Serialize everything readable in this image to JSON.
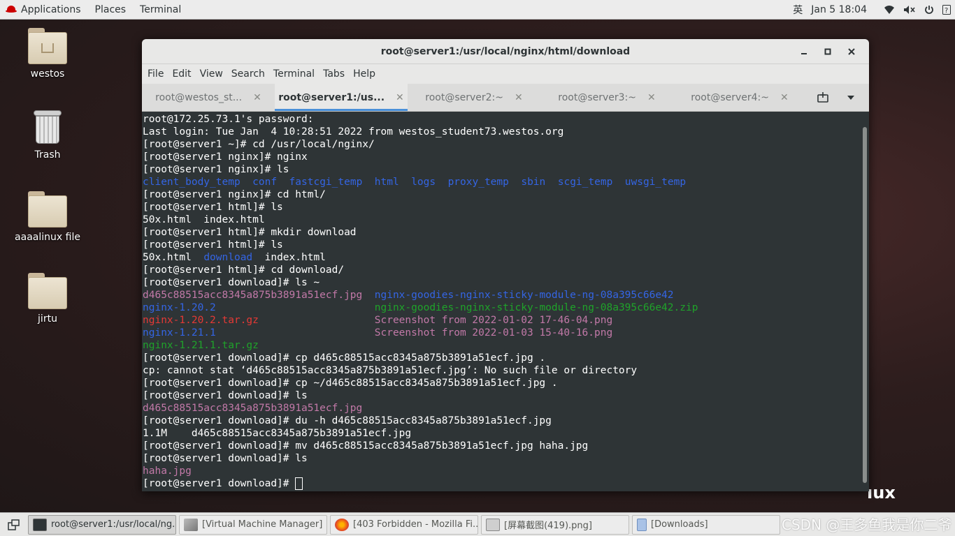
{
  "topbar": {
    "applications": "Applications",
    "places": "Places",
    "terminal": "Terminal",
    "input_method": "英",
    "datetime": "Jan 5  18:04"
  },
  "desktop": {
    "icons": [
      {
        "label": "westos"
      },
      {
        "label": "Trash"
      },
      {
        "label": "aaaalinux file"
      },
      {
        "label": "jirtu"
      }
    ],
    "brand_text": "ıux"
  },
  "window": {
    "title": "root@server1:/usr/local/nginx/html/download",
    "menu": [
      "File",
      "Edit",
      "View",
      "Search",
      "Terminal",
      "Tabs",
      "Help"
    ],
    "tabs": [
      {
        "label": "root@westos_st...",
        "active": false
      },
      {
        "label": "root@server1:/us...",
        "active": true
      },
      {
        "label": "root@server2:~",
        "active": false
      },
      {
        "label": "root@server3:~",
        "active": false
      },
      {
        "label": "root@server4:~",
        "active": false
      }
    ]
  },
  "terminal": {
    "lines": [
      [
        {
          "t": "root@172.25.73.1's password:",
          "c": ""
        }
      ],
      [
        {
          "t": "Last login: Tue Jan  4 10:28:51 2022 from westos_student73.westos.org",
          "c": ""
        }
      ],
      [
        {
          "t": "[root@server1 ~]# cd /usr/local/nginx/",
          "c": ""
        }
      ],
      [
        {
          "t": "[root@server1 nginx]# nginx",
          "c": ""
        }
      ],
      [
        {
          "t": "[root@server1 nginx]# ls",
          "c": ""
        }
      ],
      [
        {
          "t": "client_body_temp",
          "c": "c-blue"
        },
        {
          "t": "  ",
          "c": ""
        },
        {
          "t": "conf",
          "c": "c-blue"
        },
        {
          "t": "  ",
          "c": ""
        },
        {
          "t": "fastcgi_temp",
          "c": "c-blue"
        },
        {
          "t": "  ",
          "c": ""
        },
        {
          "t": "html",
          "c": "c-blue"
        },
        {
          "t": "  ",
          "c": ""
        },
        {
          "t": "logs",
          "c": "c-blue"
        },
        {
          "t": "  ",
          "c": ""
        },
        {
          "t": "proxy_temp",
          "c": "c-blue"
        },
        {
          "t": "  ",
          "c": ""
        },
        {
          "t": "sbin",
          "c": "c-blue"
        },
        {
          "t": "  ",
          "c": ""
        },
        {
          "t": "scgi_temp",
          "c": "c-blue"
        },
        {
          "t": "  ",
          "c": ""
        },
        {
          "t": "uwsgi_temp",
          "c": "c-blue"
        }
      ],
      [
        {
          "t": "[root@server1 nginx]# cd html/",
          "c": ""
        }
      ],
      [
        {
          "t": "[root@server1 html]# ls",
          "c": ""
        }
      ],
      [
        {
          "t": "50x.html  index.html",
          "c": ""
        }
      ],
      [
        {
          "t": "[root@server1 html]# mkdir download",
          "c": ""
        }
      ],
      [
        {
          "t": "[root@server1 html]# ls",
          "c": ""
        }
      ],
      [
        {
          "t": "50x.html  ",
          "c": ""
        },
        {
          "t": "download",
          "c": "c-blue"
        },
        {
          "t": "  index.html",
          "c": ""
        }
      ],
      [
        {
          "t": "[root@server1 html]# cd download/",
          "c": ""
        }
      ],
      [
        {
          "t": "[root@server1 download]# ls ~",
          "c": ""
        }
      ],
      [
        {
          "t": "d465c88515acc8345a875b3891a51ecf.jpg",
          "c": "c-pink"
        },
        {
          "t": "  ",
          "c": ""
        },
        {
          "t": "nginx-goodies-nginx-sticky-module-ng-08a395c66e42",
          "c": "c-blue"
        }
      ],
      [
        {
          "t": "nginx-1.20.2",
          "c": "c-blue"
        },
        {
          "t": "                          ",
          "c": ""
        },
        {
          "t": "nginx-goodies-nginx-sticky-module-ng-08a395c66e42.zip",
          "c": "c-green"
        }
      ],
      [
        {
          "t": "nginx-1.20.2.tar.gz",
          "c": "c-red"
        },
        {
          "t": "                   ",
          "c": ""
        },
        {
          "t": "Screenshot from 2022-01-02 17-46-04.png",
          "c": "c-pink"
        }
      ],
      [
        {
          "t": "nginx-1.21.1",
          "c": "c-blue"
        },
        {
          "t": "                          ",
          "c": ""
        },
        {
          "t": "Screenshot from 2022-01-03 15-40-16.png",
          "c": "c-pink"
        }
      ],
      [
        {
          "t": "nginx-1.21.1.tar.gz",
          "c": "c-green"
        }
      ],
      [
        {
          "t": "[root@server1 download]# cp d465c88515acc8345a875b3891a51ecf.jpg .",
          "c": ""
        }
      ],
      [
        {
          "t": "cp: cannot stat ‘d465c88515acc8345a875b3891a51ecf.jpg’: No such file or directory",
          "c": ""
        }
      ],
      [
        {
          "t": "[root@server1 download]# cp ~/d465c88515acc8345a875b3891a51ecf.jpg .",
          "c": ""
        }
      ],
      [
        {
          "t": "[root@server1 download]# ls",
          "c": ""
        }
      ],
      [
        {
          "t": "d465c88515acc8345a875b3891a51ecf.jpg",
          "c": "c-pink"
        }
      ],
      [
        {
          "t": "[root@server1 download]# du -h d465c88515acc8345a875b3891a51ecf.jpg",
          "c": ""
        }
      ],
      [
        {
          "t": "1.1M    d465c88515acc8345a875b3891a51ecf.jpg",
          "c": ""
        }
      ],
      [
        {
          "t": "[root@server1 download]# mv d465c88515acc8345a875b3891a51ecf.jpg haha.jpg",
          "c": ""
        }
      ],
      [
        {
          "t": "[root@server1 download]# ls",
          "c": ""
        }
      ],
      [
        {
          "t": "haha.jpg",
          "c": "c-pink"
        }
      ],
      [
        {
          "t": "[root@server1 download]# ",
          "c": ""
        }
      ]
    ]
  },
  "taskbar": {
    "tasks": [
      {
        "label": "root@server1:/usr/local/ng...",
        "active": true,
        "icon": "terminal-icon"
      },
      {
        "label": "[Virtual Machine Manager]",
        "active": false,
        "icon": "vm-manager-icon"
      },
      {
        "label": "[403 Forbidden - Mozilla Fi...",
        "active": false,
        "icon": "firefox-icon"
      },
      {
        "label": "[屏幕截图(419).png]",
        "active": false,
        "icon": "image-viewer-icon"
      },
      {
        "label": "[Downloads]",
        "active": false,
        "icon": "file-manager-icon"
      }
    ]
  },
  "watermark": "CSDN @王多鱼我是你二爷",
  "colors": {
    "terminal_bg": "#2e3436",
    "dir_blue": "#3465e4",
    "image_pink": "#c279a8",
    "archive_red": "#e53935",
    "archive_green": "#1fa32a",
    "tab_accent": "#4a90d9"
  }
}
